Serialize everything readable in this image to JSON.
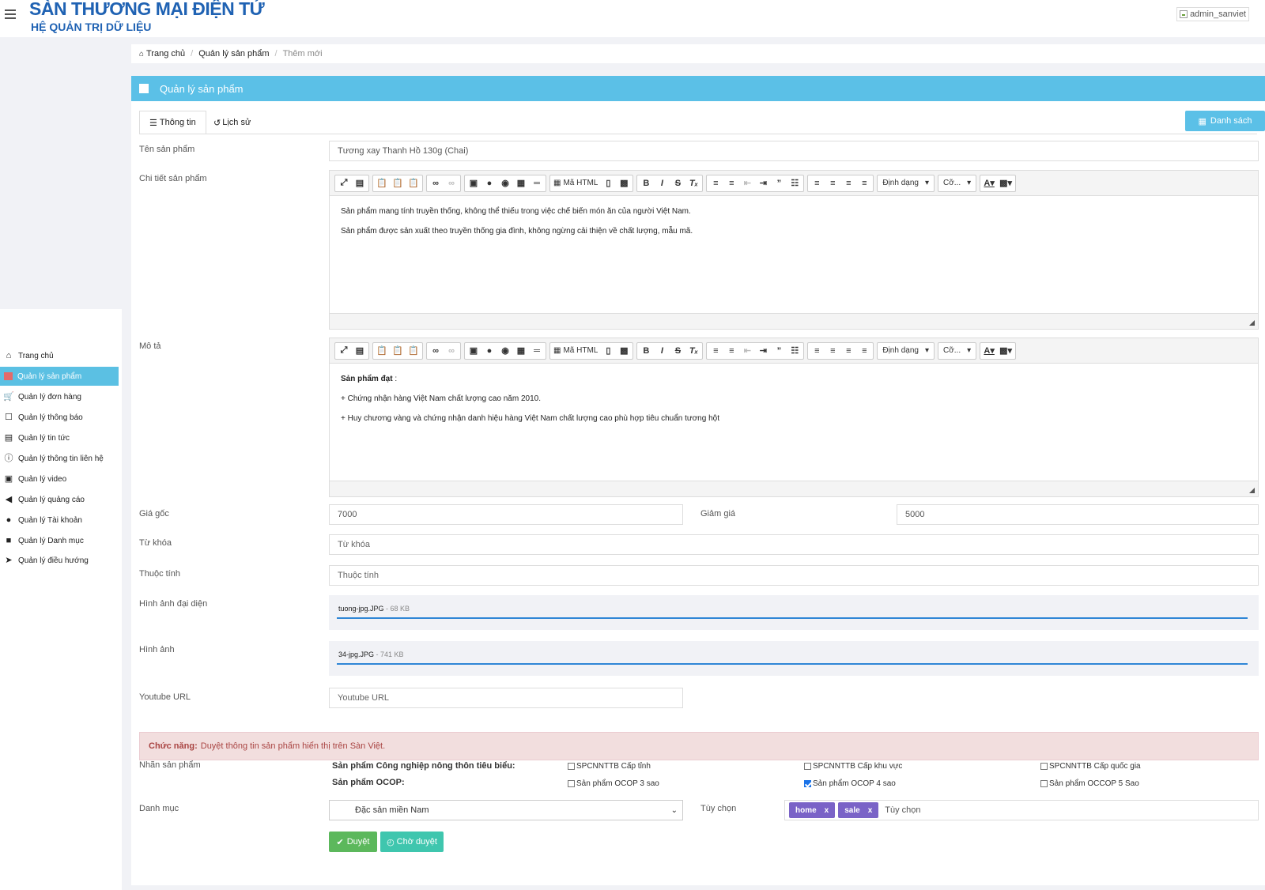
{
  "header": {
    "brand_title": "SÀN THƯƠNG MẠI ĐIỆN TỬ",
    "brand_subtitle": "HỆ QUẢN TRỊ DỮ LIỆU",
    "user": "admin_sanviet"
  },
  "sidebar": {
    "items": [
      {
        "label": "Trang chủ",
        "icon": "home-icon"
      },
      {
        "label": "Quản lý sản phẩm",
        "icon": "product-icon",
        "active": true
      },
      {
        "label": "Quản lý đơn hàng",
        "icon": "cart-icon"
      },
      {
        "label": "Quản lý thông báo",
        "icon": "bookmark-icon"
      },
      {
        "label": "Quản lý tin tức",
        "icon": "newspaper-icon"
      },
      {
        "label": "Quản lý thông tin liên hệ",
        "icon": "question-icon"
      },
      {
        "label": "Quản lý video",
        "icon": "video-icon"
      },
      {
        "label": "Quản lý quảng cáo",
        "icon": "bullhorn-icon"
      },
      {
        "label": "Quản lý Tài khoản",
        "icon": "users-icon"
      },
      {
        "label": "Quản lý Danh mục",
        "icon": "folder-icon"
      },
      {
        "label": "Quản lý điều hướng",
        "icon": "location-arrow-icon"
      }
    ]
  },
  "breadcrumb": {
    "home": "Trang chủ",
    "section": "Quản lý sản phẩm",
    "current": "Thêm mới"
  },
  "panel": {
    "title": "Quản lý sản phẩm",
    "tab_info": "Thông tin",
    "tab_history": "Lịch sử",
    "list_button": "Danh sách"
  },
  "form": {
    "name_label": "Tên sản phẩm",
    "name_value": "Tương xay Thanh Hồ 130g (Chai)",
    "detail_label": "Chi tiết sản phẩm",
    "detail_lines": [
      "Sản phẩm mang tính truyền thống, không thể thiếu trong việc chế biến món ăn của người Việt Nam.",
      "Sản phẩm được sản xuất theo truyền thống gia đình, không ngừng cải thiện về chất lượng, mẫu mã."
    ],
    "desc_label": "Mô tả",
    "desc_heading": "Sản phẩm đạt",
    "desc_heading_suffix": ":",
    "desc_lines": [
      "+ Chứng nhận hàng Việt Nam chất lượng cao năm 2010.",
      "+ Huy chương vàng và chứng nhận danh hiệu hàng Việt Nam chất lượng cao phù hợp tiêu chuẩn tương hột"
    ],
    "toolbar": {
      "html_source": "Mã HTML",
      "format": "Định dạng",
      "size": "Cỡ..."
    },
    "price_label": "Giá gốc",
    "price_value": "7000",
    "discount_label": "Giảm giá",
    "discount_value": "5000",
    "keyword_label": "Từ khóa",
    "keyword_placeholder": "Từ khóa",
    "attr_label": "Thuộc tính",
    "attr_placeholder": "Thuộc tính",
    "avatar_label": "Hình ảnh đại diện",
    "avatar_file": "tuong-jpg.JPG",
    "avatar_size": " - 68 KB",
    "images_label": "Hình ảnh",
    "images_file": "34-jpg.JPG",
    "images_size": " - 741 KB",
    "youtube_label": "Youtube URL",
    "youtube_placeholder": "Youtube URL",
    "alert_bold": "Chức năng:",
    "alert_text": "Duyệt thông tin sản phẩm hiển thị trên Sàn Việt.",
    "tag_label": "Nhãn sản phẩm",
    "group1_title": "Sản phẩm Công nghiệp nông thôn tiêu biểu:",
    "group2_title": "Sản phẩm OCOP:",
    "checks_row1": [
      {
        "label": "SPCNNTTB Cấp tỉnh",
        "checked": false
      },
      {
        "label": "SPCNNTTB Cấp khu vực",
        "checked": false
      },
      {
        "label": "SPCNNTTB Cấp quốc gia",
        "checked": false
      }
    ],
    "checks_row2": [
      {
        "label": "Sản phẩm OCOP 3 sao",
        "checked": false
      },
      {
        "label": "Sản phẩm OCOP 4 sao",
        "checked": true
      },
      {
        "label": "Sản phẩm OCCOP 5 Sao",
        "checked": false
      }
    ],
    "category_label": "Danh mục",
    "category_value": "Đặc sản miền Nam",
    "options_label": "Tùy chọn",
    "tags": [
      "home",
      "sale"
    ],
    "tag_remove": "x",
    "tags_placeholder": "Tùy chọn",
    "approve_button": "Duyệt",
    "pending_button": "Chờ duyệt"
  }
}
